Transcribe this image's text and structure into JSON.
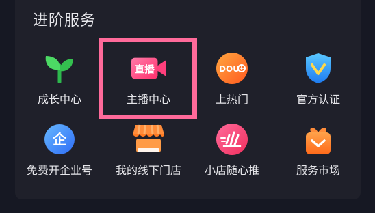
{
  "section": {
    "title": "进阶服务"
  },
  "services": [
    {
      "label": "成长中心",
      "icon": "sprout-icon"
    },
    {
      "label": "主播中心",
      "icon": "live-camera-icon",
      "icon_text": "直播"
    },
    {
      "label": "上热门",
      "icon": "dou-plus-icon",
      "icon_text": "DOU"
    },
    {
      "label": "官方认证",
      "icon": "verified-shield-icon"
    },
    {
      "label": "免费开企业号",
      "icon": "enterprise-icon",
      "icon_text": "企"
    },
    {
      "label": "我的线下门店",
      "icon": "storefront-icon"
    },
    {
      "label": "小店随心推",
      "icon": "boost-icon"
    },
    {
      "label": "服务市场",
      "icon": "gift-bag-icon"
    }
  ],
  "colors": {
    "background": "#161823",
    "card": "#1f202a",
    "highlight": "#ff6a9a"
  }
}
